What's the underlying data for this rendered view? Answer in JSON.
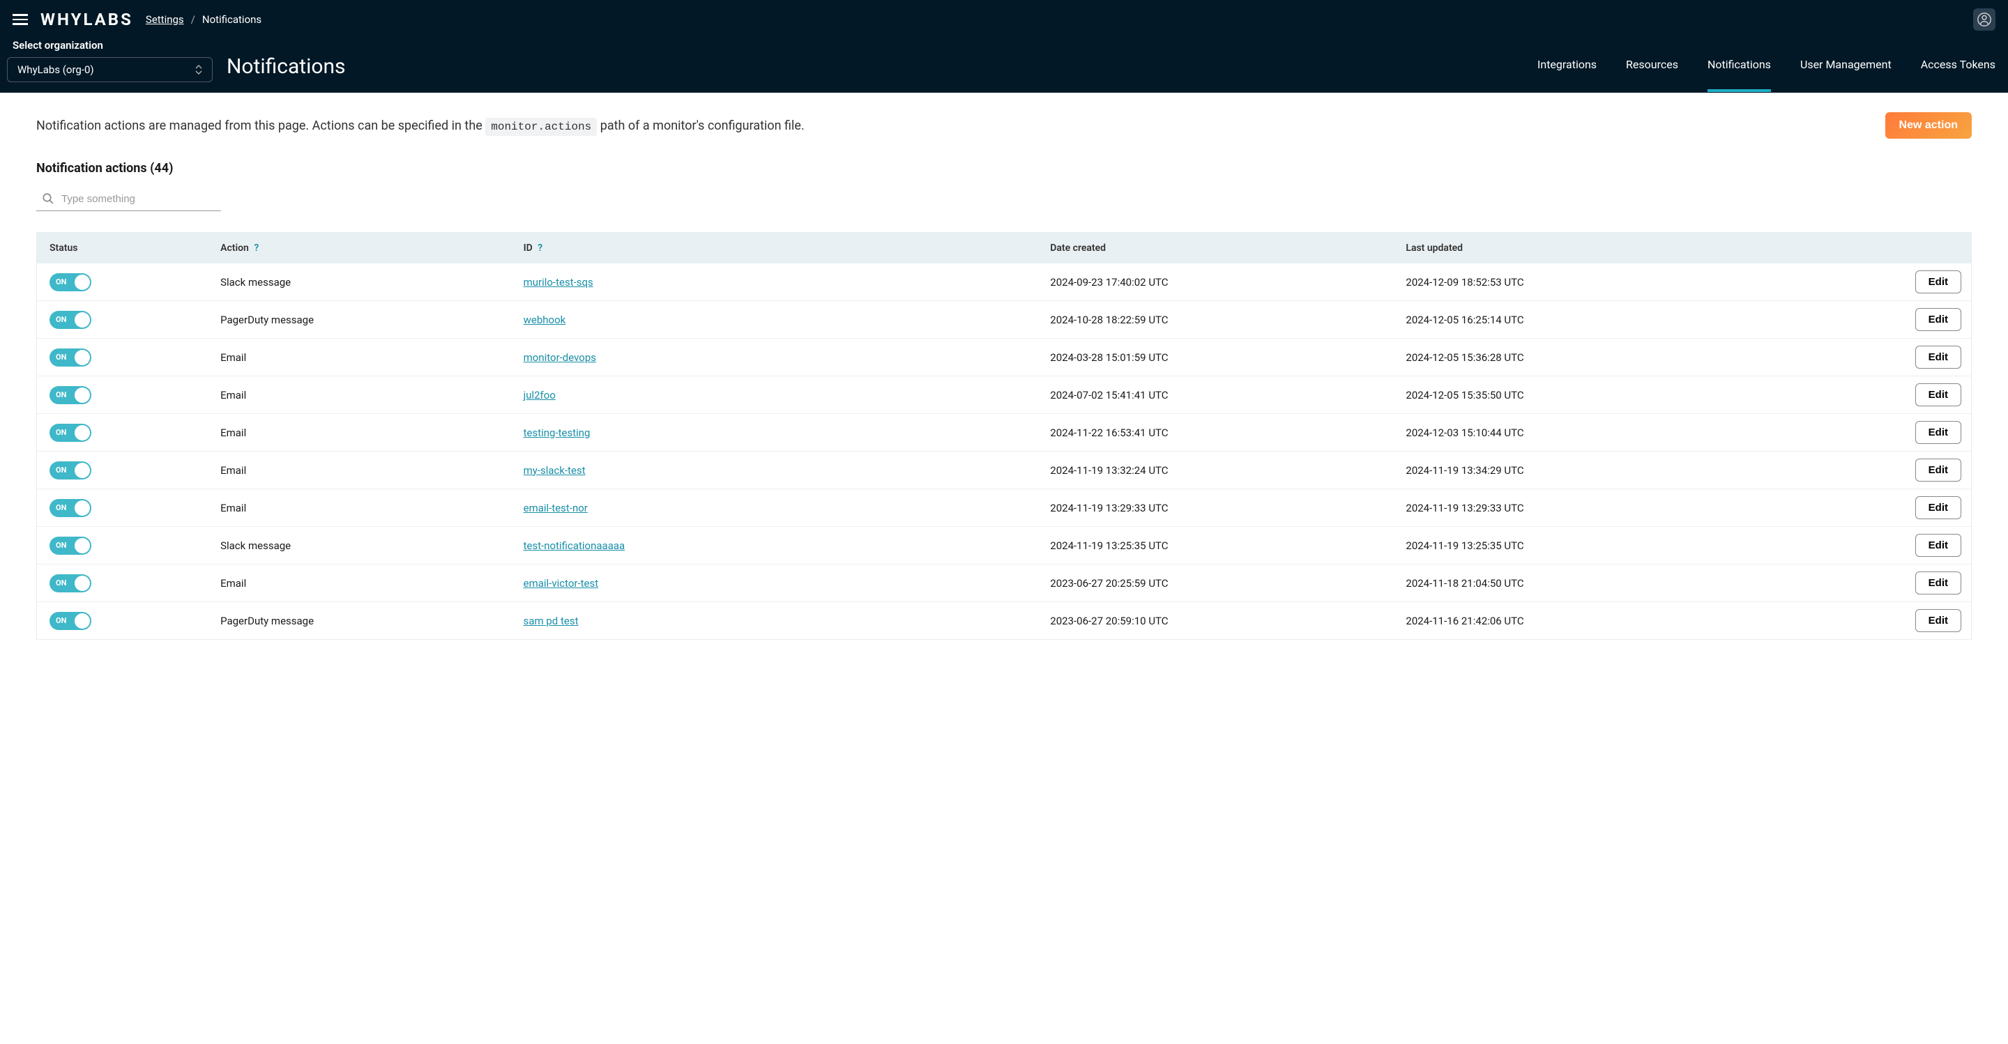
{
  "header": {
    "logo": "WHYLABS",
    "breadcrumbs": {
      "settings": "Settings",
      "separator": "/",
      "current": "Notifications"
    },
    "org": {
      "label": "Select organization",
      "value": "WhyLabs (org-0)"
    },
    "page_title": "Notifications",
    "nav": {
      "integrations": "Integrations",
      "resources": "Resources",
      "notifications": "Notifications",
      "user_management": "User Management",
      "access_tokens": "Access Tokens"
    }
  },
  "intro": {
    "text_before": "Notification actions are managed from this page. Actions can be specified in the ",
    "code": "monitor.actions",
    "text_after": " path of a monitor's configuration file.",
    "new_action_label": "New action"
  },
  "section": {
    "title": "Notification actions (44)"
  },
  "search": {
    "placeholder": "Type something"
  },
  "table": {
    "columns": {
      "status": "Status",
      "action": "Action",
      "id": "ID",
      "date_created": "Date created",
      "last_updated": "Last updated"
    },
    "toggle_label": "ON",
    "edit_label": "Edit",
    "help": "?",
    "rows": [
      {
        "action": "Slack message",
        "id": "murilo-test-sqs",
        "created": "2024-09-23 17:40:02 UTC",
        "updated": "2024-12-09 18:52:53 UTC"
      },
      {
        "action": "PagerDuty message",
        "id": "webhook",
        "created": "2024-10-28 18:22:59 UTC",
        "updated": "2024-12-05 16:25:14 UTC"
      },
      {
        "action": "Email",
        "id": "monitor-devops",
        "created": "2024-03-28 15:01:59 UTC",
        "updated": "2024-12-05 15:36:28 UTC"
      },
      {
        "action": "Email",
        "id": "jul2foo",
        "created": "2024-07-02 15:41:41 UTC",
        "updated": "2024-12-05 15:35:50 UTC"
      },
      {
        "action": "Email",
        "id": "testing-testing",
        "created": "2024-11-22 16:53:41 UTC",
        "updated": "2024-12-03 15:10:44 UTC"
      },
      {
        "action": "Email",
        "id": "my-slack-test",
        "created": "2024-11-19 13:32:24 UTC",
        "updated": "2024-11-19 13:34:29 UTC"
      },
      {
        "action": "Email",
        "id": "email-test-nor",
        "created": "2024-11-19 13:29:33 UTC",
        "updated": "2024-11-19 13:29:33 UTC"
      },
      {
        "action": "Slack message",
        "id": "test-notificationaaaaa",
        "created": "2024-11-19 13:25:35 UTC",
        "updated": "2024-11-19 13:25:35 UTC"
      },
      {
        "action": "Email",
        "id": "email-victor-test",
        "created": "2023-06-27 20:25:59 UTC",
        "updated": "2024-11-18 21:04:50 UTC"
      },
      {
        "action": "PagerDuty message",
        "id": "sam pd test",
        "created": "2023-06-27 20:59:10 UTC",
        "updated": "2024-11-16 21:42:06 UTC"
      }
    ]
  }
}
